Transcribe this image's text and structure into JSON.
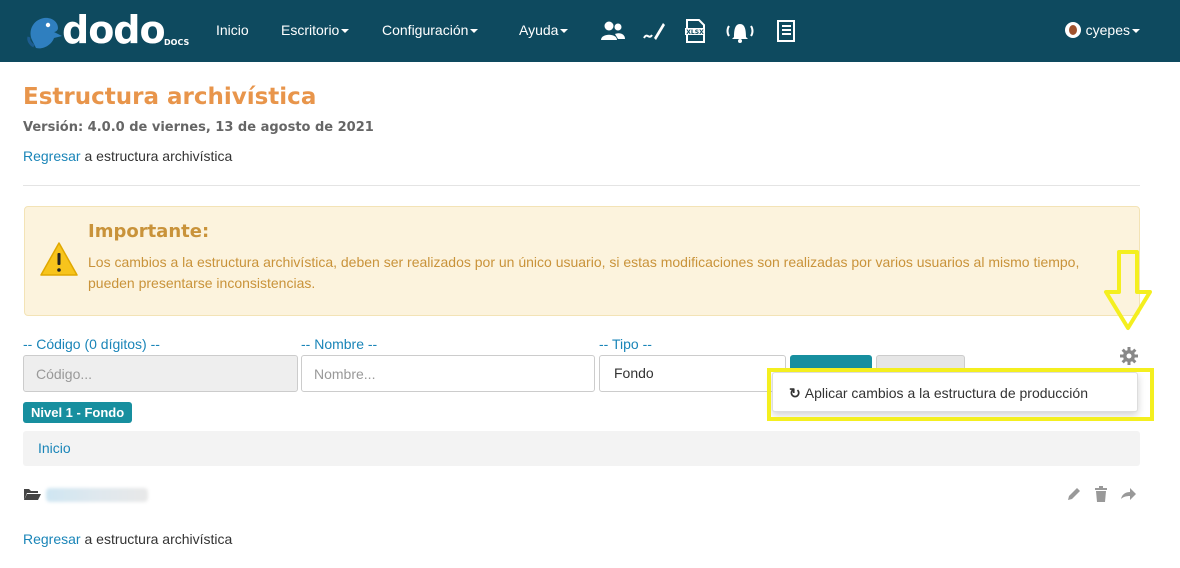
{
  "app": {
    "brand": "dodo",
    "brand_sub": "DOCS"
  },
  "nav": {
    "inicio": "Inicio",
    "escritorio": "Escritorio",
    "configuracion": "Configuración",
    "ayuda": "Ayuda",
    "icons": [
      "users-icon",
      "signature-icon",
      "xlsx-icon",
      "bell-icon",
      "document-list-icon"
    ],
    "user": "cyepes"
  },
  "page": {
    "title": "Estructura archivística",
    "version": "Versión: 4.0.0 de viernes, 13 de agosto de 2021",
    "back_link": "Regresar",
    "back_text": " a estructura archivística"
  },
  "alert": {
    "title": "Importante:",
    "text": "Los cambios a la estructura archivística, deben ser realizados por un único usuario, si estas modificaciones son realizadas por varios usuarios al mismo tiempo, pueden presentarse inconsistencias."
  },
  "filters": {
    "codigo_label": "-- Código (0 dígitos) --",
    "codigo_placeholder": "Código...",
    "nombre_label": "-- Nombre --",
    "nombre_placeholder": "Nombre...",
    "tipo_label": "-- Tipo --",
    "tipo_value": "Fondo",
    "tipo_clear": "×"
  },
  "dropdown": {
    "apply_changes": "Aplicar cambios a la estructura de producción"
  },
  "level_badge": "Nivel 1 - Fondo",
  "breadcrumb": {
    "inicio": "Inicio"
  },
  "colors": {
    "navbar": "#0e4a5f",
    "title_orange": "#e8954b",
    "link_blue": "#1a85b8",
    "teal": "#178f9f",
    "highlight_yellow": "#f4ef1f",
    "alert_bg": "#fcf3dd",
    "alert_text": "#c9933a"
  }
}
